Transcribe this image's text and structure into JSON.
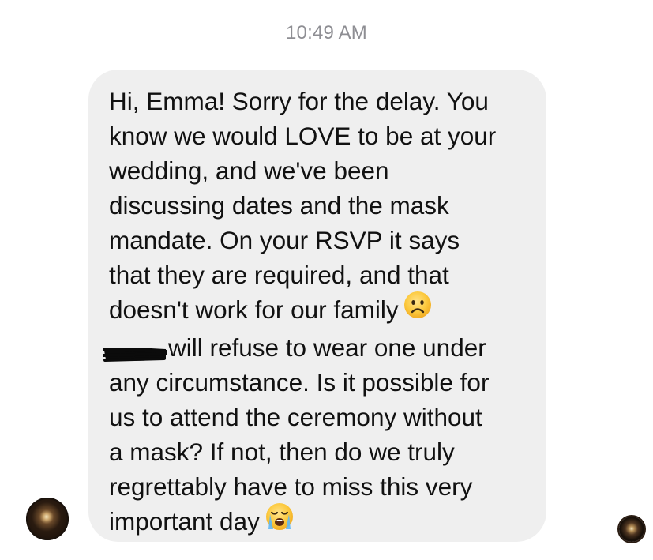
{
  "timestamp": "10:49 AM",
  "message": {
    "lines": [
      "Hi, Emma! Sorry for the delay. You",
      "know we would LOVE to be at your",
      "wedding, and we've been",
      "discussing dates and the mask",
      "mandate. On your RSVP it says",
      "that they are required, and that",
      "doesn't work for our family",
      "will refuse to wear one under",
      "any circumstance. Is it possible for",
      "us to attend the ceremony without",
      "a mask? If not, then do we truly",
      "regrettably have to miss this very",
      "important day"
    ],
    "emojis": [
      "frowning-face-emoji",
      "loudly-crying-face-emoji"
    ],
    "redacted_name": true
  },
  "avatars": {
    "sender": "contact-avatar",
    "read_receipt": "read-receipt-avatar"
  },
  "colors": {
    "bubble": "#efefef",
    "text": "#111111",
    "timestamp": "#8e8e93",
    "background": "#ffffff"
  }
}
